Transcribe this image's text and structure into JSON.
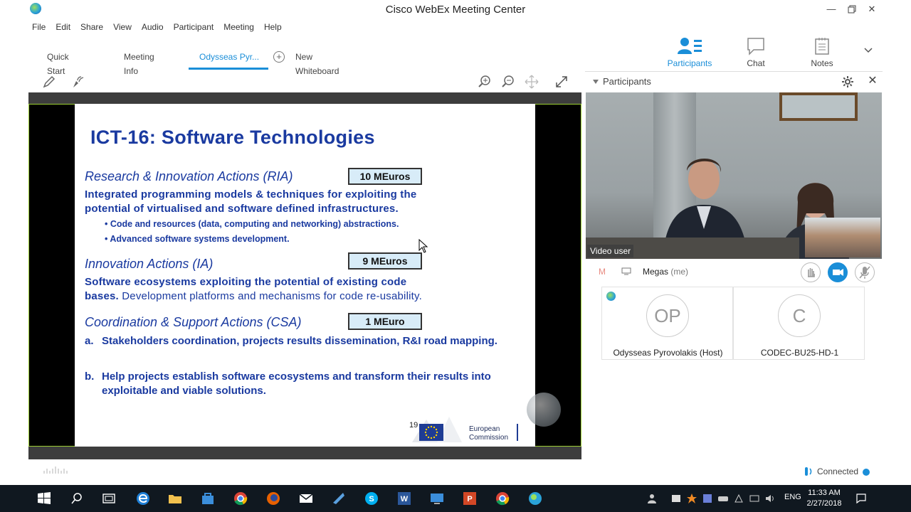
{
  "window": {
    "title": "Cisco WebEx Meeting Center"
  },
  "menu": [
    "File",
    "Edit",
    "Share",
    "View",
    "Audio",
    "Participant",
    "Meeting",
    "Help"
  ],
  "tabs": {
    "quick_start": "Quick Start",
    "meeting_info": "Meeting Info",
    "active": "Odysseas Pyr...",
    "new_whiteboard": "New Whiteboard"
  },
  "panels": {
    "participants": "Participants",
    "chat": "Chat",
    "notes": "Notes"
  },
  "slide": {
    "title": "ICT-16: Software Technologies",
    "ria_heading": "Research & Innovation Actions (RIA)",
    "ria_badge": "10 MEuros",
    "ria_line1": "Integrated programming models & techniques for exploiting the",
    "ria_line2": "potential of virtualised and software defined infrastructures.",
    "ria_bullet1": "• Code and resources (data, computing and networking) abstractions.",
    "ria_bullet2": "• Advanced software systems development.",
    "ia_heading": "Innovation Actions (IA)",
    "ia_badge": "9 MEuros",
    "ia_line1": "Software ecosystems exploiting the potential of existing code",
    "ia_line2_bold": "bases.",
    "ia_line2_normal": " Development platforms and mechanisms for code re-usability.",
    "csa_heading": "Coordination & Support Actions (CSA)",
    "csa_badge": "1 MEuro",
    "csa_a_num": "a.",
    "csa_a_text": "Stakeholders coordination, projects results dissemination, R&I road mapping.",
    "csa_b_num": "b.",
    "csa_b_text": "Help projects establish software ecosystems and  transform their results into exploitable and viable solutions.",
    "page_number": "19",
    "eu_line1": "European",
    "eu_line2": "Commission"
  },
  "participants_panel": {
    "header": "Participants",
    "video_label": "Video user",
    "me_initial": "M",
    "me_name": "Megas",
    "me_suffix": " (me)",
    "cards": [
      {
        "initials": "OP",
        "name": "Odysseas Pyrovolakis (Host)"
      },
      {
        "initials": "C",
        "name": "CODEC-BU25-HD-1"
      }
    ]
  },
  "status": {
    "connected": "Connected"
  },
  "taskbar": {
    "lang": "ENG",
    "time": "11:33 AM",
    "date": "2/27/2018"
  },
  "colors": {
    "accent": "#1a8ed8",
    "slide_text": "#1a3aa0",
    "badge_bg": "#d8ecf8"
  }
}
